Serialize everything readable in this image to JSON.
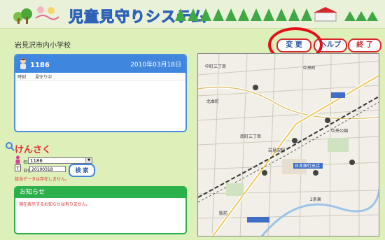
{
  "header": {
    "title": "児童見守りシステム"
  },
  "school": "岩見沢市内小学校",
  "toolbar": {
    "change_label": "変 更",
    "help_label": "ヘルプ",
    "exit_label": "終 了"
  },
  "status_panel": {
    "user_id": "1186",
    "date": "2010年03月18日",
    "rows": [
      {
        "col1": "時刻",
        "col2": "見守り中"
      }
    ]
  },
  "search": {
    "title": "けんさく",
    "name_label": "名前",
    "name_value": "1186",
    "date_label": "日付",
    "date_value": "20100318",
    "button_label": "検 索",
    "no_data": "該当データは存在しません。"
  },
  "notice": {
    "title": "お知らせ",
    "message": "現在表示するお知らせは有りません。"
  },
  "map": {
    "labels": [
      "中町三丁目",
      "中央町",
      "北本町",
      "南町三丁目",
      "中央公園",
      "岩見沢駅",
      "日本銀行支店",
      "駅前",
      "2条東"
    ]
  },
  "colors": {
    "accent_red": "#d9272e",
    "panel_blue": "#3f86de",
    "notice_green": "#2bb04a",
    "background": "#ddf0b9"
  }
}
